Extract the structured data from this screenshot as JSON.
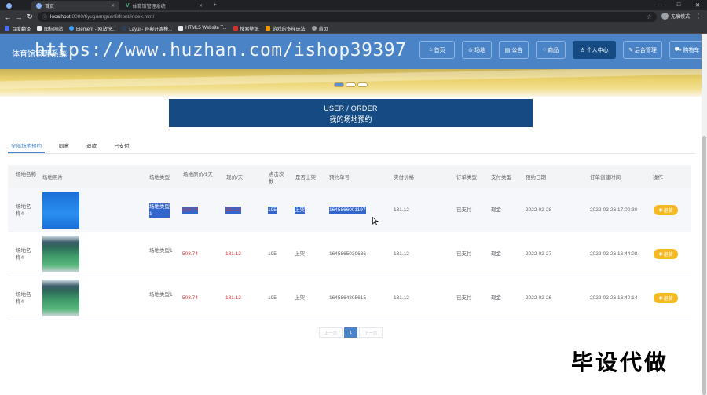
{
  "browser": {
    "tabs": [
      {
        "title": "首页",
        "active": true
      },
      {
        "title": "体育馆管理系统",
        "active": false
      }
    ],
    "new_tab": "+",
    "window_controls": [
      "—",
      "□",
      "✕"
    ],
    "url_host": "localhost",
    "url_path": ":8080/tiyuguanguanli/front/index.html",
    "profile_label": "无痕模式",
    "bookmarks": [
      "百度翻译",
      "图标网站",
      "Element - 网站快...",
      "Layui - 经典开源模...",
      "HTML5 Website T...",
      "搜索壁纸",
      "游戏的多样玩法",
      "首页"
    ]
  },
  "site": {
    "title": "体育馆管理系统",
    "watermark": "https://www.huzhan.com/ishop39397",
    "nav": [
      {
        "icon": "home-icon",
        "label": "首页"
      },
      {
        "icon": "venue-icon",
        "label": "场地"
      },
      {
        "icon": "news-icon",
        "label": "公告"
      },
      {
        "icon": "shop-icon",
        "label": "商品"
      },
      {
        "icon": "user-icon",
        "label": "个人中心",
        "active": true
      },
      {
        "icon": "admin-icon",
        "label": "后台管理"
      },
      {
        "icon": "cart-icon",
        "label": "购物车"
      }
    ]
  },
  "page": {
    "heading_en": "USER / ORDER",
    "heading_cn": "我的场地预约",
    "tabs": [
      {
        "label": "全部场地预约",
        "active": true
      },
      {
        "label": "同意"
      },
      {
        "label": "退款"
      },
      {
        "label": "已支付"
      }
    ]
  },
  "table": {
    "headers": [
      "场地名称",
      "场地照片",
      "场地类型",
      "场地原价/1天",
      "现价/天",
      "点击次数",
      "是否上架",
      "预约单号",
      "实付价格",
      "订单类型",
      "支付类型",
      "预约日期",
      "订单创建时间",
      "操作"
    ],
    "rows": [
      {
        "name": "场地名称4",
        "photo": "blue",
        "type": "场地类型1",
        "orig_price": "508.74",
        "price": "181.12",
        "clicks": "195",
        "listed": "上架",
        "order_no": "1645866001197",
        "paid": "181.12",
        "order_type": "已支付",
        "pay_type": "现金",
        "date": "2022-02-28",
        "created": "2022-02-26 17:00:30",
        "action": "退款",
        "selected": true
      },
      {
        "name": "场地名称4",
        "photo": "court",
        "type": "场地类型1",
        "orig_price": "508.74",
        "price": "181.12",
        "clicks": "195",
        "listed": "上架",
        "order_no": "1645865039636",
        "paid": "181.12",
        "order_type": "已支付",
        "pay_type": "现金",
        "date": "2022-02-27",
        "created": "2022-02-26 16:44:08",
        "action": "退款"
      },
      {
        "name": "场地名称4",
        "photo": "court",
        "type": "场地类型1",
        "orig_price": "508.74",
        "price": "181.12",
        "clicks": "195",
        "listed": "上架",
        "order_no": "1645864805615",
        "paid": "181.12",
        "order_type": "已支付",
        "pay_type": "现金",
        "date": "2022-02-26",
        "created": "2022-02-26 16:40:14",
        "action": "退款"
      }
    ]
  },
  "pager": {
    "prev": "上一页",
    "current": "1",
    "next": "下一页"
  },
  "overlay_text": "毕设代做",
  "colors": {
    "header": "#4a84c7",
    "active": "#154a82",
    "price_red": "#d33c3c",
    "refund": "#f5b921"
  }
}
